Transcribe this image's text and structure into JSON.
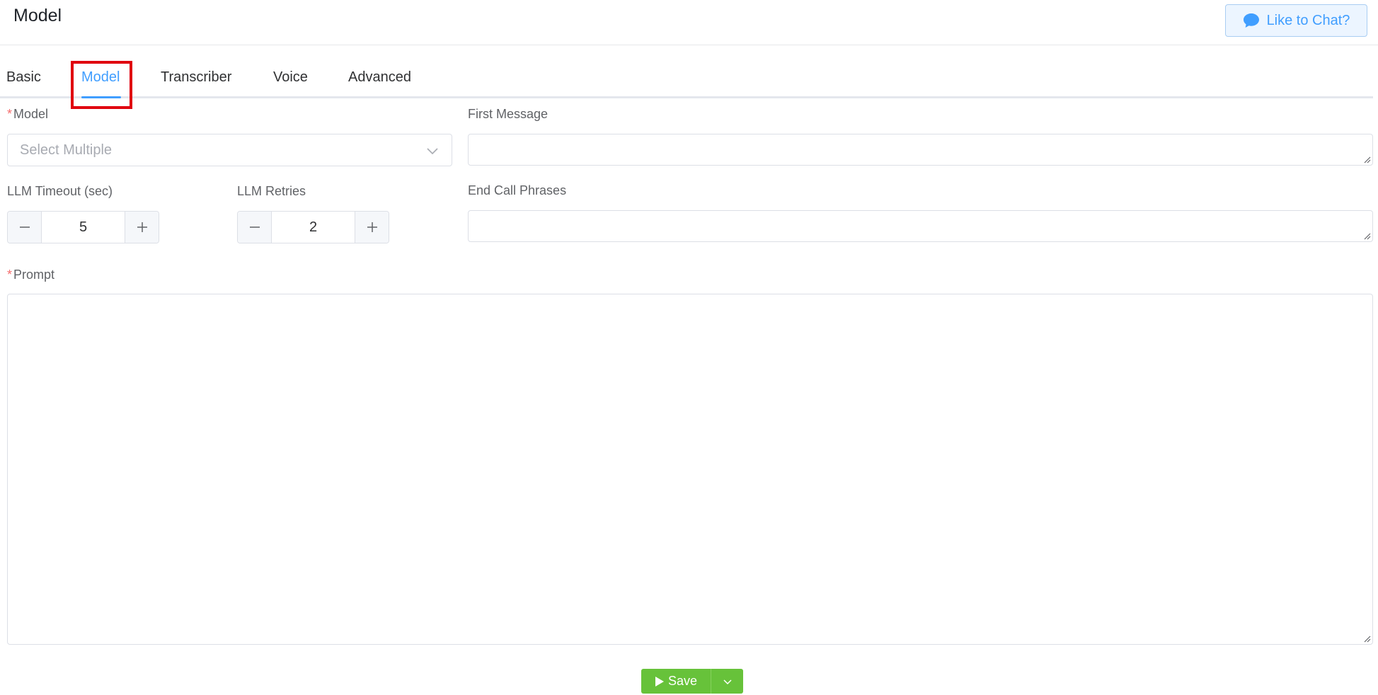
{
  "header": {
    "title": "Model",
    "chat_button_label": "Like to Chat?"
  },
  "tabs": [
    {
      "label": "Basic",
      "active": false
    },
    {
      "label": "Model",
      "active": true
    },
    {
      "label": "Transcriber",
      "active": false
    },
    {
      "label": "Voice",
      "active": false
    },
    {
      "label": "Advanced",
      "active": false
    }
  ],
  "form": {
    "model": {
      "label": "Model",
      "required": true,
      "placeholder": "Select Multiple"
    },
    "first_message": {
      "label": "First Message",
      "value": ""
    },
    "llm_timeout": {
      "label": "LLM Timeout (sec)",
      "value": "5"
    },
    "llm_retries": {
      "label": "LLM Retries",
      "value": "2"
    },
    "end_call_phrases": {
      "label": "End Call Phrases",
      "value": ""
    },
    "prompt": {
      "label": "Prompt",
      "required": true,
      "value": ""
    }
  },
  "footer": {
    "save_label": "Save"
  },
  "colors": {
    "accent": "#409eff",
    "success": "#67c23a",
    "required": "#f56c6c",
    "highlight": "#e0000f"
  },
  "icons": {
    "chat": "chat-bubble-icon",
    "dropdown": "chevron-down-icon",
    "save": "play-icon"
  }
}
